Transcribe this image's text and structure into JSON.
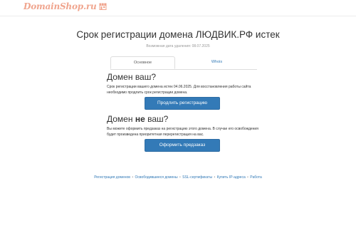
{
  "header": {
    "logo_text": "DomainShop.ru",
    "logo_icon": "shop-icon",
    "accent_color": "#f0a58e"
  },
  "page": {
    "title": "Срок регистрации домена ЛЮДВИК.РФ истек",
    "subtitle": "Возможная дата удаления: 08.07.2025"
  },
  "tabs": [
    {
      "label": "Основное",
      "active": true
    },
    {
      "label": "Whois",
      "active": false
    }
  ],
  "owner_section": {
    "heading": "Домен ваш?",
    "text": "Срок регистрации вашего домена истек 04.06.2025. Для восстановления работы сайта необходимо продлить срок регистрации домена.",
    "button_label": "Продлить регистрацию"
  },
  "not_owner_section": {
    "heading_prefix": "Домен ",
    "heading_bold": "не",
    "heading_suffix": " ваш?",
    "text": "Вы можете оформить предзаказ на регистрацию этого домена. В случае его освобождения будет произведена приоритетная перерегистрация на вас.",
    "button_label": "Оформить предзаказ"
  },
  "footer": {
    "links": [
      "Регистрация доменов",
      "Освободившиеся домены",
      "SSL-сертификаты",
      "Купить IP-адреса",
      "Работа"
    ],
    "separator": "•"
  },
  "colors": {
    "button": "#337ab7",
    "link": "#337ab7"
  }
}
